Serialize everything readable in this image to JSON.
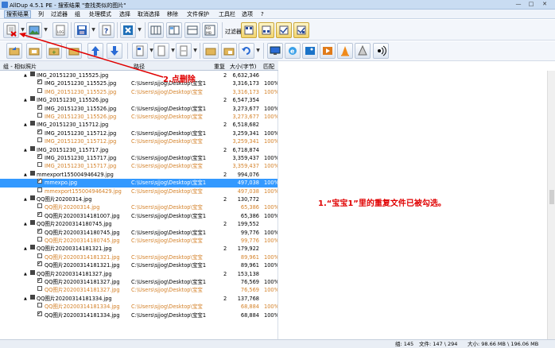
{
  "window": {
    "title": "AllDup 4.5.1 PE - 搜索结果 \"查找类似的图片\"",
    "min": "—",
    "max": "□",
    "close": "✕"
  },
  "menu": [
    "搜索结果",
    "列",
    "过滤器",
    "组",
    "处理模式",
    "选择",
    "取消选择",
    "移除",
    "文件保护",
    "工具栏",
    "选项",
    "?"
  ],
  "toolbar": {
    "filter_label": "过滤器:"
  },
  "columns": {
    "group": "组 - 相似照片",
    "path": "路径",
    "dup": "重复",
    "size": "大小(字节)",
    "match": "匹配"
  },
  "rows": [
    {
      "type": "group",
      "name": "IMG_20151230_115525.jpg",
      "dup": "2",
      "size": "6,632,346"
    },
    {
      "type": "checked",
      "name": "IMG_20151230_115525.jpg",
      "path": "C:\\Users\\sjjog\\Desktop\\宝宝1",
      "size": "3,316,173",
      "match": "100%"
    },
    {
      "type": "orange",
      "name": "IMG_20151230_115525.jpg",
      "path": "C:\\Users\\sjjog\\Desktop\\宝宝",
      "size": "3,316,173",
      "match": "100%"
    },
    {
      "type": "group",
      "name": "IMG_20151230_115526.jpg",
      "dup": "2",
      "size": "6,547,354"
    },
    {
      "type": "checked",
      "name": "IMG_20151230_115526.jpg",
      "path": "C:\\Users\\sjjog\\Desktop\\宝宝1",
      "size": "3,273,677",
      "match": "100%"
    },
    {
      "type": "orange",
      "name": "IMG_20151230_115526.jpg",
      "path": "C:\\Users\\sjjog\\Desktop\\宝宝",
      "size": "3,273,677",
      "match": "100%"
    },
    {
      "type": "group",
      "name": "IMG_20151230_115712.jpg",
      "dup": "2",
      "size": "6,518,682"
    },
    {
      "type": "checked",
      "name": "IMG_20151230_115712.jpg",
      "path": "C:\\Users\\sjjog\\Desktop\\宝宝1",
      "size": "3,259,341",
      "match": "100%"
    },
    {
      "type": "orange",
      "name": "IMG_20151230_115712.jpg",
      "path": "C:\\Users\\sjjog\\Desktop\\宝宝",
      "size": "3,259,341",
      "match": "100%"
    },
    {
      "type": "group",
      "name": "IMG_20151230_115717.jpg",
      "dup": "2",
      "size": "6,718,874"
    },
    {
      "type": "checked",
      "name": "IMG_20151230_115717.jpg",
      "path": "C:\\Users\\sjjog\\Desktop\\宝宝1",
      "size": "3,359,437",
      "match": "100%"
    },
    {
      "type": "orange",
      "name": "IMG_20151230_115717.jpg",
      "path": "C:\\Users\\sjjog\\Desktop\\宝宝",
      "size": "3,359,437",
      "match": "100%"
    },
    {
      "type": "group",
      "name": "mmexport155004946429.jpg",
      "dup": "2",
      "size": "994,076"
    },
    {
      "type": "sel",
      "name": "mmexpo.jpg",
      "path": "C:\\Users\\sjjog\\Desktop\\宝宝1",
      "size": "497,038",
      "match": "100%"
    },
    {
      "type": "orange",
      "name": "mmexport155004946429.jpg",
      "path": "C:\\Users\\sjjog\\Desktop\\宝宝",
      "size": "497,038",
      "match": "100%"
    },
    {
      "type": "group",
      "name": "QQ图片20200314.jpg",
      "dup": "2",
      "size": "130,772"
    },
    {
      "type": "orange",
      "name": "QQ图片20200314.jpg",
      "path": "C:\\Users\\sjjog\\Desktop\\宝宝",
      "size": "65,386",
      "match": "100%"
    },
    {
      "type": "checked",
      "name": "QQ图片20200314181007.jpg",
      "path": "C:\\Users\\sjjog\\Desktop\\宝宝1",
      "size": "65,386",
      "match": "100%"
    },
    {
      "type": "group",
      "name": "QQ图片20200314180745.jpg",
      "dup": "2",
      "size": "199,552"
    },
    {
      "type": "checked",
      "name": "QQ图片20200314180745.jpg",
      "path": "C:\\Users\\sjjog\\Desktop\\宝宝1",
      "size": "99,776",
      "match": "100%"
    },
    {
      "type": "orange",
      "name": "QQ图片20200314180745.jpg",
      "path": "C:\\Users\\sjjog\\Desktop\\宝宝",
      "size": "99,776",
      "match": "100%"
    },
    {
      "type": "group",
      "name": "QQ图片20200314181321.jpg",
      "dup": "2",
      "size": "179,922"
    },
    {
      "type": "orange",
      "name": "QQ图片20200314181321.jpg",
      "path": "C:\\Users\\sjjog\\Desktop\\宝宝",
      "size": "89,961",
      "match": "100%"
    },
    {
      "type": "checked",
      "name": "QQ图片20200314181321.jpg",
      "path": "C:\\Users\\sjjog\\Desktop\\宝宝1",
      "size": "89,961",
      "match": "100%"
    },
    {
      "type": "group",
      "name": "QQ图片20200314181327.jpg",
      "dup": "2",
      "size": "153,138"
    },
    {
      "type": "checked",
      "name": "QQ图片20200314181327.jpg",
      "path": "C:\\Users\\sjjog\\Desktop\\宝宝1",
      "size": "76,569",
      "match": "100%"
    },
    {
      "type": "orange",
      "name": "QQ图片20200314181327.jpg",
      "path": "C:\\Users\\sjjog\\Desktop\\宝宝",
      "size": "76,569",
      "match": "100%"
    },
    {
      "type": "group",
      "name": "QQ图片20200314181334.jpg",
      "dup": "2",
      "size": "137,768"
    },
    {
      "type": "orange",
      "name": "QQ图片20200314181334.jpg",
      "path": "C:\\Users\\sjjog\\Desktop\\宝宝",
      "size": "68,884",
      "match": "100%"
    },
    {
      "type": "checked",
      "name": "QQ图片20200314181334.jpg",
      "path": "C:\\Users\\sjjog\\Desktop\\宝宝1",
      "size": "68,884",
      "match": "100%"
    }
  ],
  "status": {
    "groups": "组: 145",
    "files": "文件: 147 \\ 294",
    "size": "大小: 98.66 MB \\ 196.06 MB"
  },
  "annotations": {
    "note1": "1.“宝宝1”里的重复文件已被勾选。",
    "note2": "2.点删除"
  },
  "colors": {
    "accent_selected": "#3399ff",
    "orange_text": "#d4822a",
    "annotation_red": "#e00000"
  }
}
